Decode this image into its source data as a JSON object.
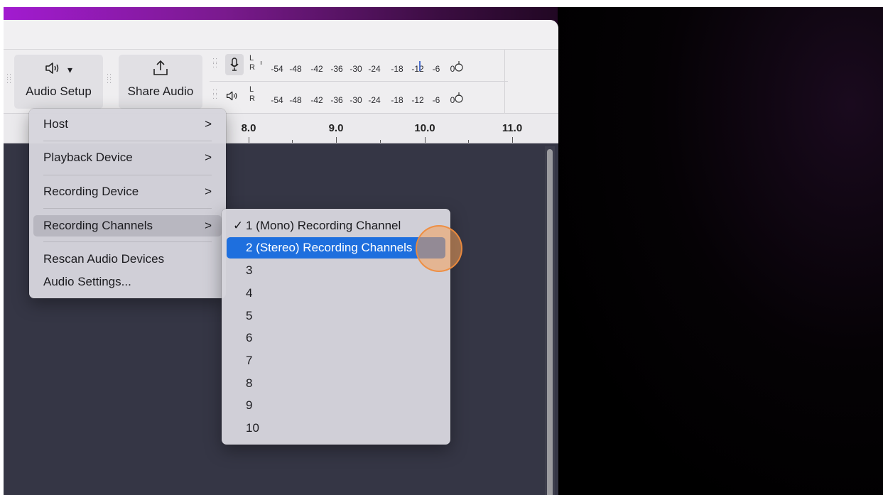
{
  "toolbar": {
    "audio_setup": {
      "label": "Audio Setup",
      "icon": "speaker-icon",
      "caret": "▾"
    },
    "share_audio": {
      "label": "Share Audio",
      "icon": "share-icon"
    }
  },
  "meters": {
    "record": {
      "icon": "microphone-icon",
      "channels": [
        "L",
        "R"
      ]
    },
    "playback": {
      "icon": "speaker-icon",
      "channels": [
        "L",
        "R"
      ]
    },
    "ticks": [
      "-54",
      "-48",
      "-42",
      "-36",
      "-30",
      "-24",
      "-18",
      "-12",
      "-6",
      "0"
    ]
  },
  "timeline": {
    "labels": [
      "8.0",
      "9.0",
      "10.0",
      "11.0"
    ]
  },
  "audio_setup_menu": {
    "items": [
      {
        "label": "Host",
        "submenu": true
      },
      {
        "label": "Playback Device",
        "submenu": true
      },
      {
        "label": "Recording Device",
        "submenu": true
      },
      {
        "label": "Recording Channels",
        "submenu": true,
        "highlighted": true
      },
      {
        "label": "Rescan Audio Devices",
        "submenu": false
      },
      {
        "label": "Audio Settings...",
        "submenu": false
      }
    ],
    "chevron": ">"
  },
  "channels_menu": {
    "check_mark": "✓",
    "items": [
      {
        "label": "1 (Mono) Recording Channel",
        "checked": true
      },
      {
        "label": "2 (Stereo) Recording Channels",
        "selected": true
      },
      {
        "label": "3"
      },
      {
        "label": "4"
      },
      {
        "label": "5"
      },
      {
        "label": "6"
      },
      {
        "label": "7"
      },
      {
        "label": "8"
      },
      {
        "label": "9"
      },
      {
        "label": "10"
      }
    ]
  },
  "colors": {
    "selection_blue": "#1e6fde",
    "menu_background": "#d6d5dc",
    "canvas": "#353645",
    "cursor_highlight": "#f4a05a"
  }
}
